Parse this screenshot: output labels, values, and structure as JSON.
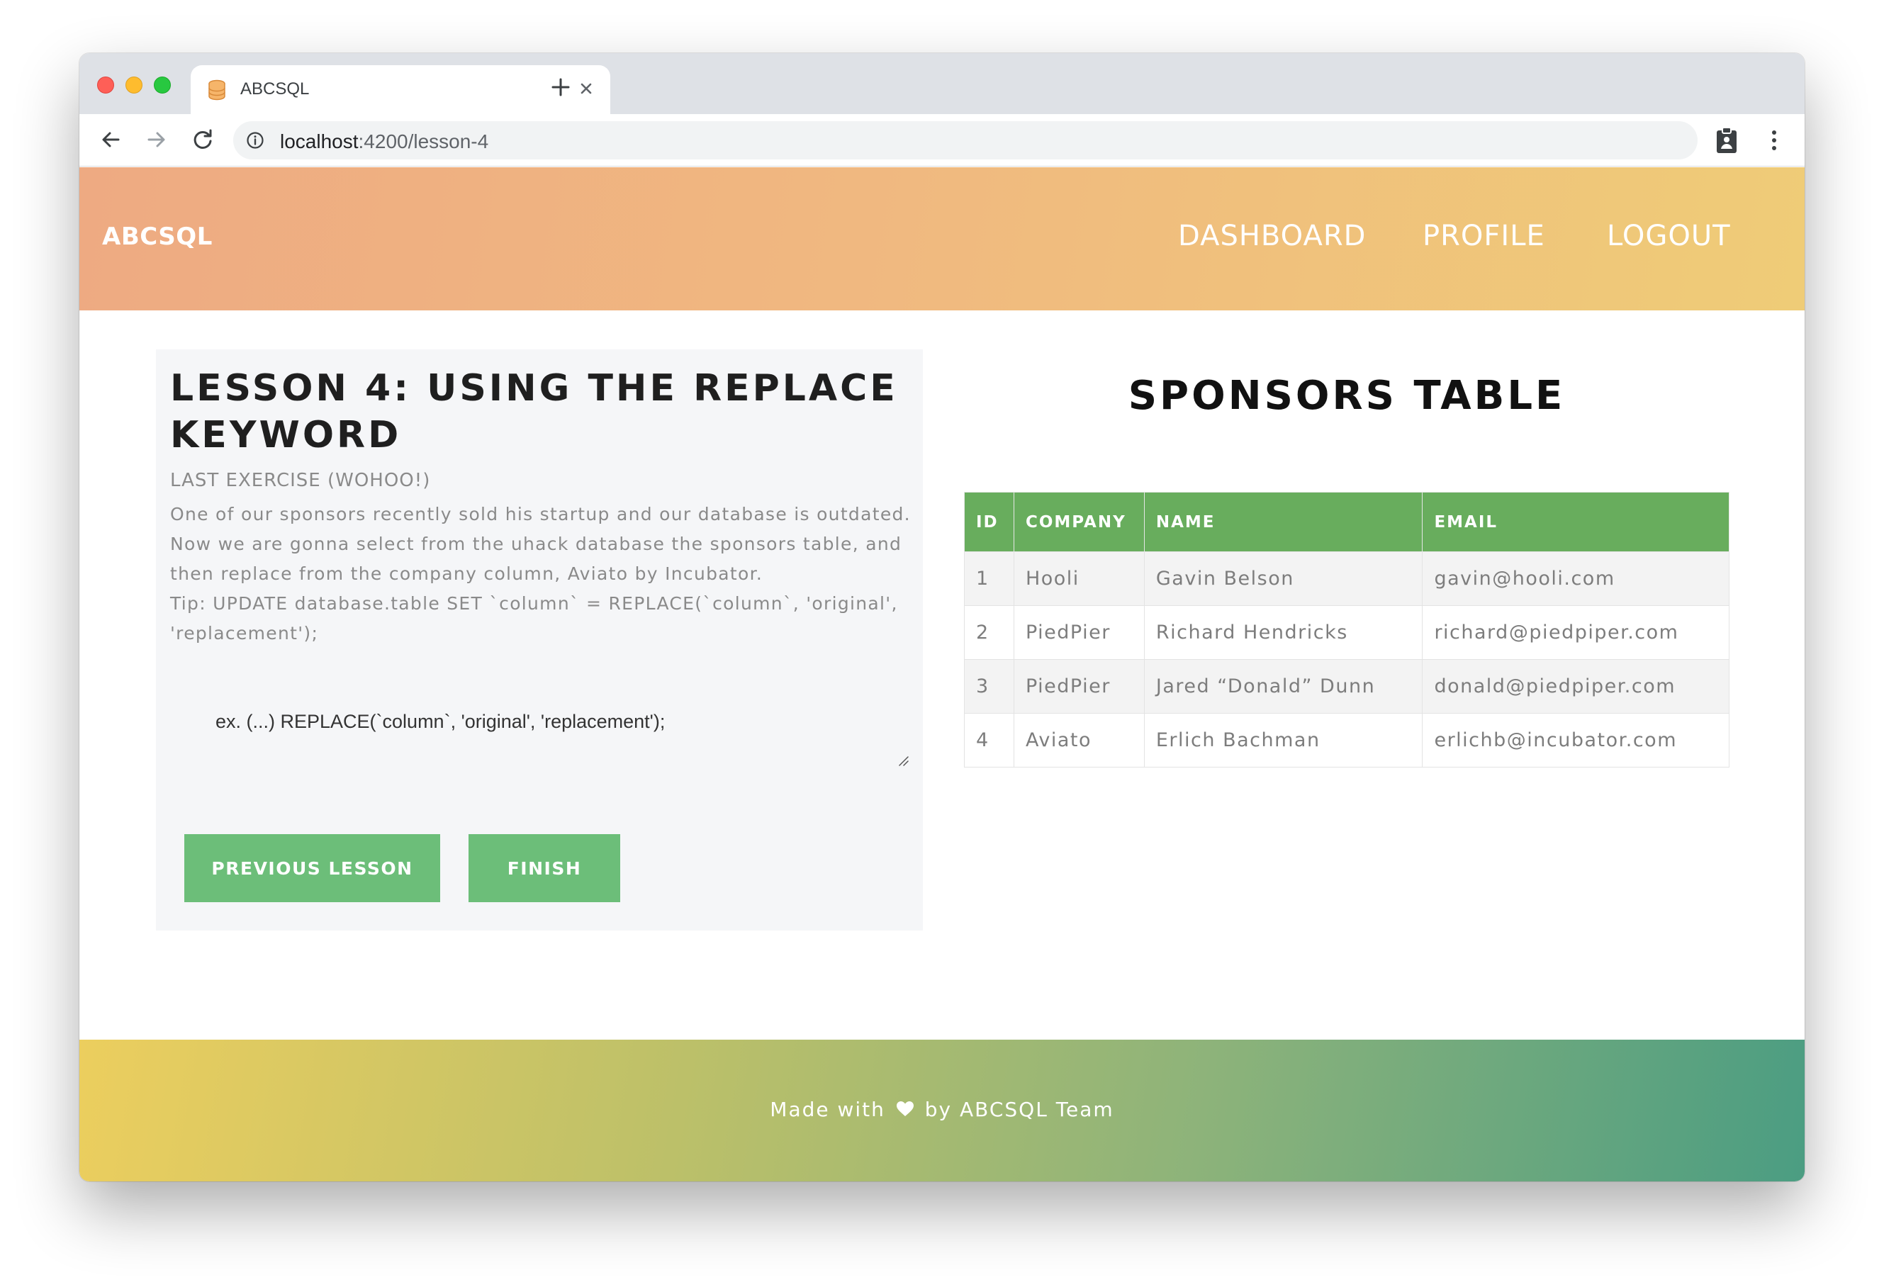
{
  "browser": {
    "tab_title": "ABCSQL",
    "url_host": "localhost",
    "url_path": ":4200/lesson-4"
  },
  "header": {
    "brand": "ABCSQL",
    "nav": {
      "dashboard": "DASHBOARD",
      "profile": "PROFILE",
      "logout": "LOGOUT"
    }
  },
  "lesson": {
    "title": "LESSON 4: USING THE REPLACE KEYWORD",
    "subtitle": "LAST EXERCISE (WOHOO!)",
    "paragraphs": [
      "One of our sponsors recently sold his startup and our database is outdated.",
      "Now we are gonna select from the uhack database the sponsors table, and then replace from the company column, Aviato by Incubator.",
      "Tip: UPDATE database.table SET `column` = REPLACE(`column`, 'original', 'replacement');"
    ],
    "query_placeholder": "ex. (...) REPLACE(`column`, 'original', 'replacement');",
    "previous_button": "PREVIOUS LESSON",
    "finish_button": "FINISH"
  },
  "sponsors": {
    "title": "SPONSORS TABLE",
    "columns": [
      "ID",
      "COMPANY",
      "NAME",
      "EMAIL"
    ],
    "rows": [
      [
        "1",
        "Hooli",
        "Gavin Belson",
        "gavin@hooli.com"
      ],
      [
        "2",
        "PiedPier",
        "Richard Hendricks",
        "richard@piedpiper.com"
      ],
      [
        "3",
        "PiedPier",
        "Jared “Donald” Dunn",
        "donald@piedpiper.com"
      ],
      [
        "4",
        "Aviato",
        "Erlich Bachman",
        "erlichb@incubator.com"
      ]
    ]
  },
  "footer": {
    "prefix": "Made with",
    "suffix": "by ABCSQL Team"
  },
  "colors": {
    "table_header": "#68ad5d",
    "button": "#6cbe79",
    "header_gradient_start": "#eeaa82",
    "header_gradient_end": "#efcc77",
    "footer_gradient_start": "#ecce5e",
    "footer_gradient_end": "#4b9d82"
  },
  "icons": {
    "tab": "database-icon",
    "close": "close-icon",
    "new_tab": "plus-icon",
    "back": "back-arrow-icon",
    "forward": "forward-arrow-icon",
    "reload": "reload-icon",
    "site_info": "info-icon",
    "extension": "clipboard-icon",
    "menu": "kebab-menu-icon",
    "footer": "heart-icon"
  }
}
